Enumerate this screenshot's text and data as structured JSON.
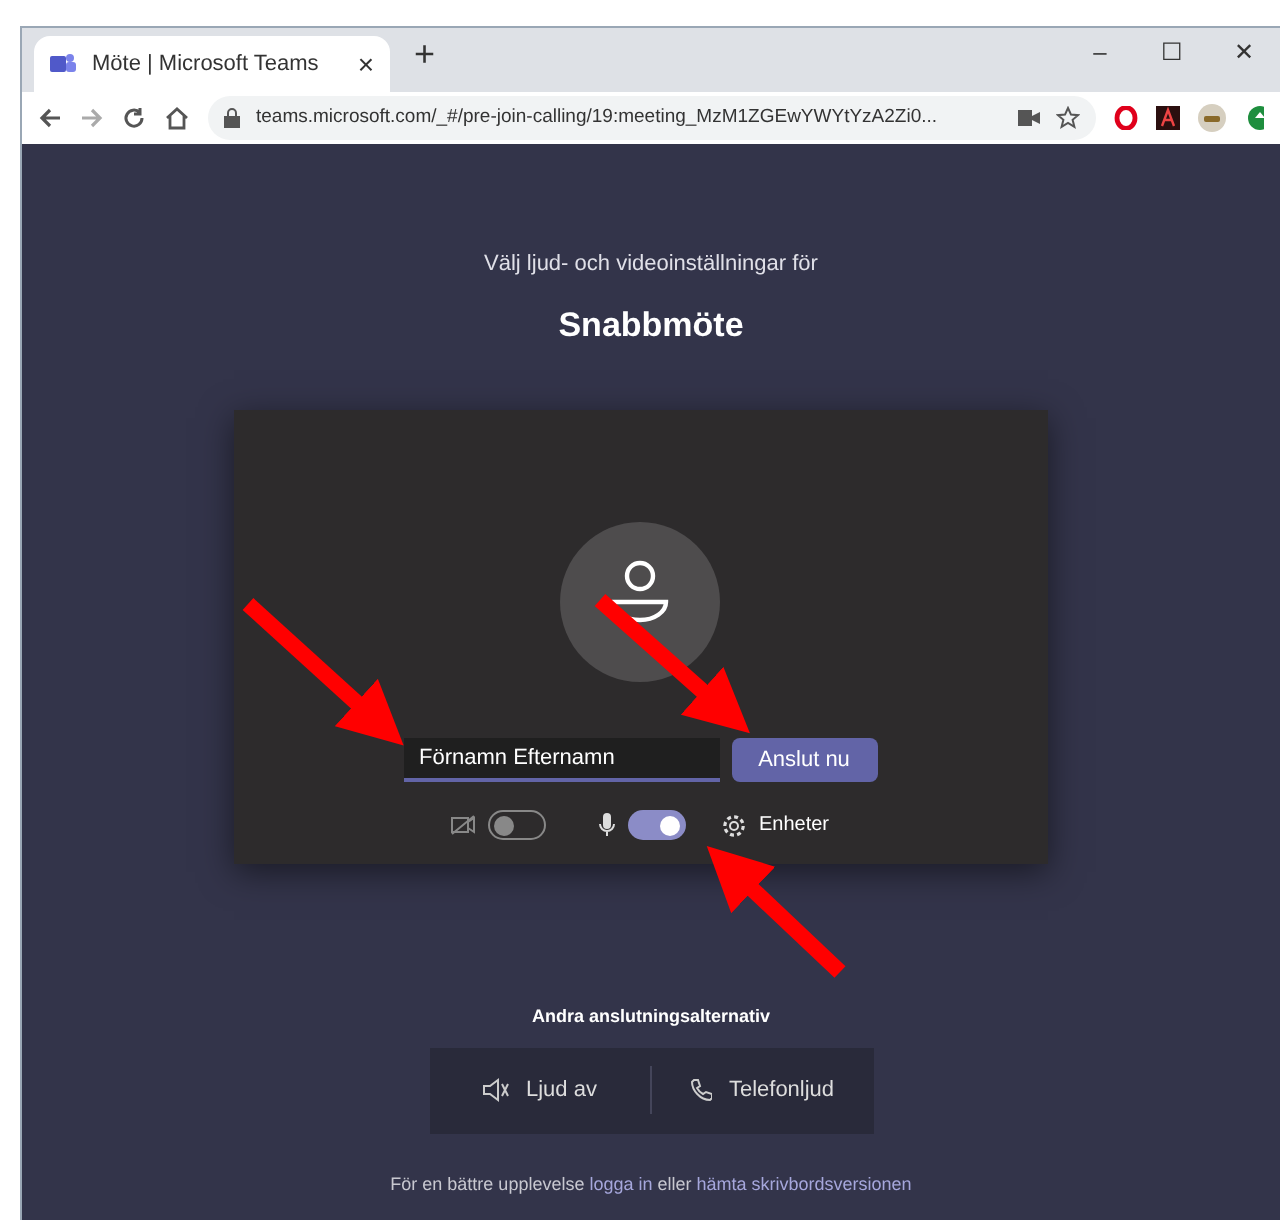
{
  "browser": {
    "tab": {
      "title": "Möte | Microsoft Teams",
      "close": "×"
    },
    "new_tab": "+",
    "window_controls": [
      "–",
      "☐",
      "✕"
    ],
    "address": "teams.microsoft.com/_#/pre-join-calling/19:meeting_MzM1ZGEwYWYtYzA2Zi0..."
  },
  "prejoin": {
    "subtitle": "Välj ljud- och videoinställningar för",
    "title": "Snabbmöte",
    "name_field": {
      "value": "Förnamn Efternamn"
    },
    "join_button": "Anslut nu",
    "toggles": [
      {
        "kind": "camera",
        "on": false
      },
      {
        "kind": "mic",
        "on": true
      }
    ],
    "devices": "Enheter"
  },
  "other_options": {
    "heading": "Andra anslutningsalternativ",
    "options": [
      {
        "kind": "audio-off",
        "label": "Ljud av"
      },
      {
        "kind": "phone",
        "label": "Telefonljud"
      }
    ]
  },
  "footer": {
    "parts": [
      {
        "kind": "text",
        "text": "För en bättre upplevelse "
      },
      {
        "kind": "link",
        "text": "logga in"
      },
      {
        "kind": "text",
        "text": " eller "
      },
      {
        "kind": "link",
        "text": "hämta skrivbordsversionen"
      }
    ]
  }
}
